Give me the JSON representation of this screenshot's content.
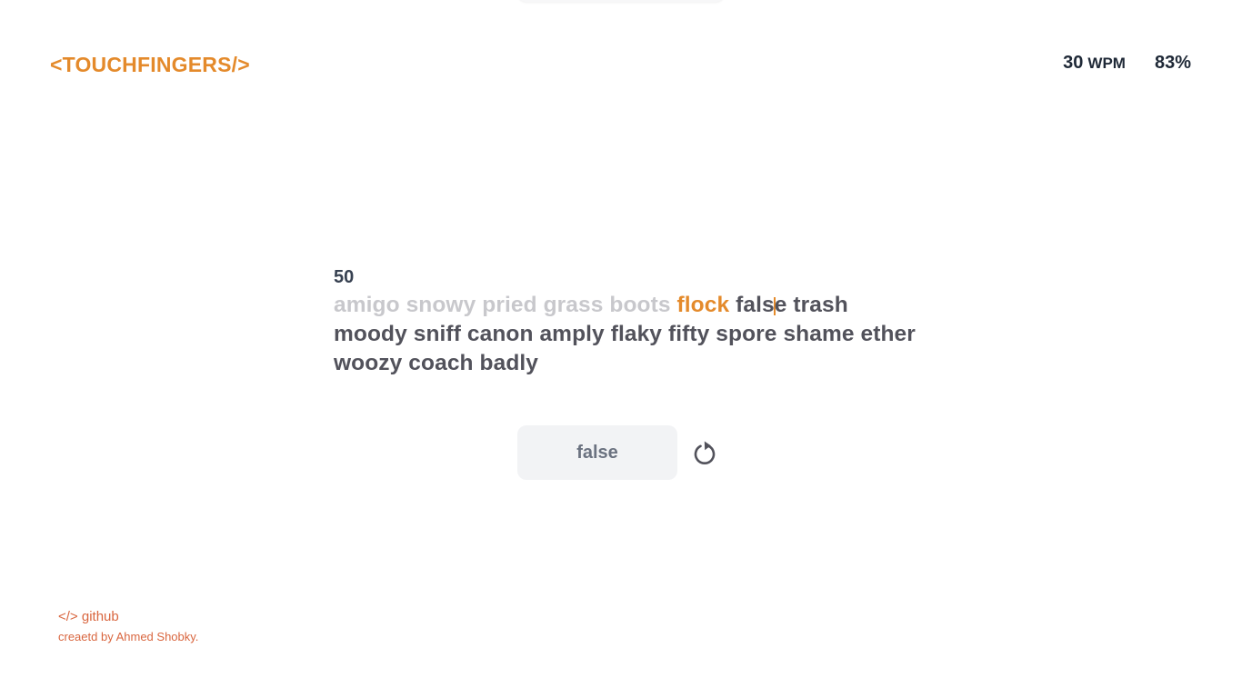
{
  "header": {
    "logo": "<TOUCHFINGERS/>",
    "stats": {
      "wpm_value": "30",
      "wpm_unit": "WPM",
      "accuracy": "83%"
    }
  },
  "test": {
    "timer": "50",
    "words": {
      "typed": [
        "amigo",
        "snowy",
        "pried",
        "grass",
        "boots"
      ],
      "active": "flock",
      "current_before_caret": "fals",
      "current_after_caret": "e",
      "line1_rest": [
        "trash"
      ],
      "line2": [
        "moody",
        "sniff",
        "canon",
        "amply",
        "flaky",
        "fifty",
        "spore",
        "shame",
        "ether"
      ],
      "line3": [
        "woozy",
        "coach",
        "badly"
      ]
    },
    "input_value": "false",
    "restart_icon": "restart-icon"
  },
  "footer": {
    "github_label": "</> github",
    "credit": "creaetd by Ahmed Shobky."
  },
  "colors": {
    "accent": "#e48a2b",
    "typed": "#c8c8cc",
    "pending": "#52525b",
    "footer": "#d9663f"
  }
}
